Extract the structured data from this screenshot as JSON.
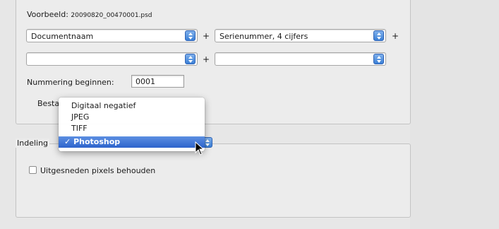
{
  "preview": {
    "label": "Voorbeeld:",
    "filename": "20090820_00470001.psd"
  },
  "naming": {
    "row1": {
      "left_value": "Documentnaam",
      "right_value": "Serienummer, 4 cijfers"
    },
    "row2": {
      "left_value": "",
      "right_value": ""
    },
    "plus": "+"
  },
  "numbering": {
    "label": "Nummering beginnen:",
    "value": "0001"
  },
  "compat_label_partial": "Besta",
  "format_menu": {
    "items": [
      "Digitaal negatief",
      "JPEG",
      "TIFF",
      "Photoshop"
    ],
    "selected": "Photoshop",
    "checkmark": "✓"
  },
  "format_section": {
    "legend": "Indeling"
  },
  "crop_option": {
    "label": "Uitgesneden pixels behouden",
    "checked": false
  }
}
